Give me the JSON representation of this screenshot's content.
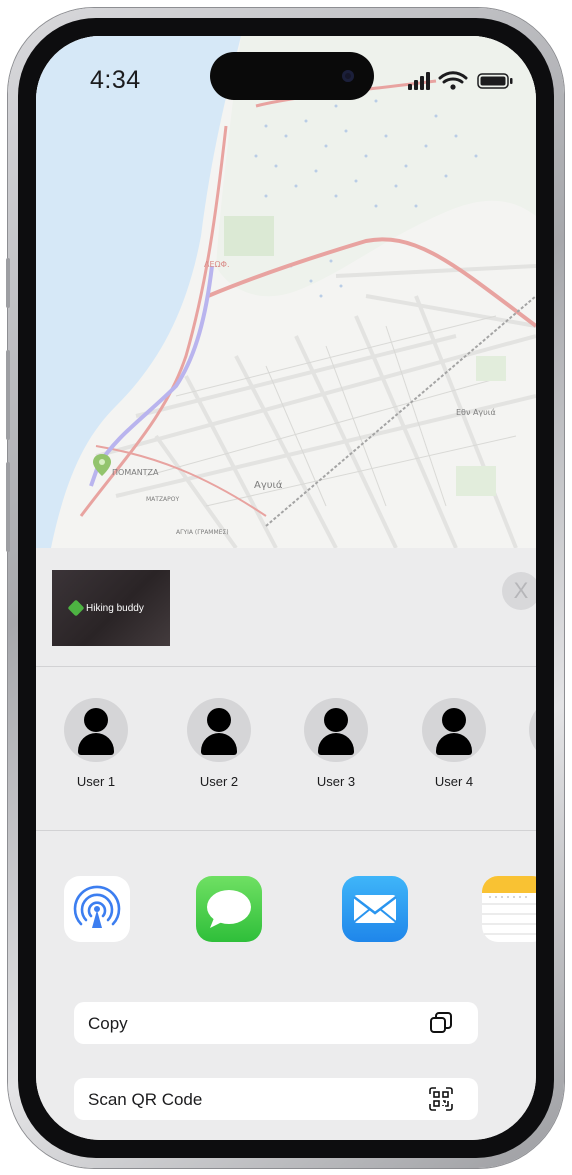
{
  "status_bar": {
    "time": "4:34"
  },
  "share": {
    "preview_title": "Hiking buddy",
    "close_symbol": "X",
    "users": [
      {
        "name": "User 1"
      },
      {
        "name": "User 2"
      },
      {
        "name": "User 3"
      },
      {
        "name": "User 4"
      },
      {
        "name": ""
      }
    ],
    "apps": [
      {
        "icon": "airdrop-icon",
        "color": "#2f6fe4"
      },
      {
        "icon": "messages-icon",
        "color": "#34c759"
      },
      {
        "icon": "mail-icon",
        "color": "#2f9bf5"
      },
      {
        "icon": "notes-icon",
        "color": "#f7c331"
      }
    ],
    "actions": [
      {
        "label": "Copy",
        "icon": "copy-icon"
      },
      {
        "label": "Scan QR Code",
        "icon": "qr-code-icon"
      }
    ]
  },
  "map": {
    "labels": [
      "ΠΟΜΑΝΤΖΑ",
      "Αγυιά",
      "ΜΑΤΖΑΡΟΥ",
      "ΑΓΥΙΑ (ΓΡΑΜΜΕΣ)",
      "ΛΕΩΦ.",
      "Εθν Αγυιά"
    ],
    "water_color": "#d6e8f7",
    "road_color": "#e8a3a0"
  }
}
